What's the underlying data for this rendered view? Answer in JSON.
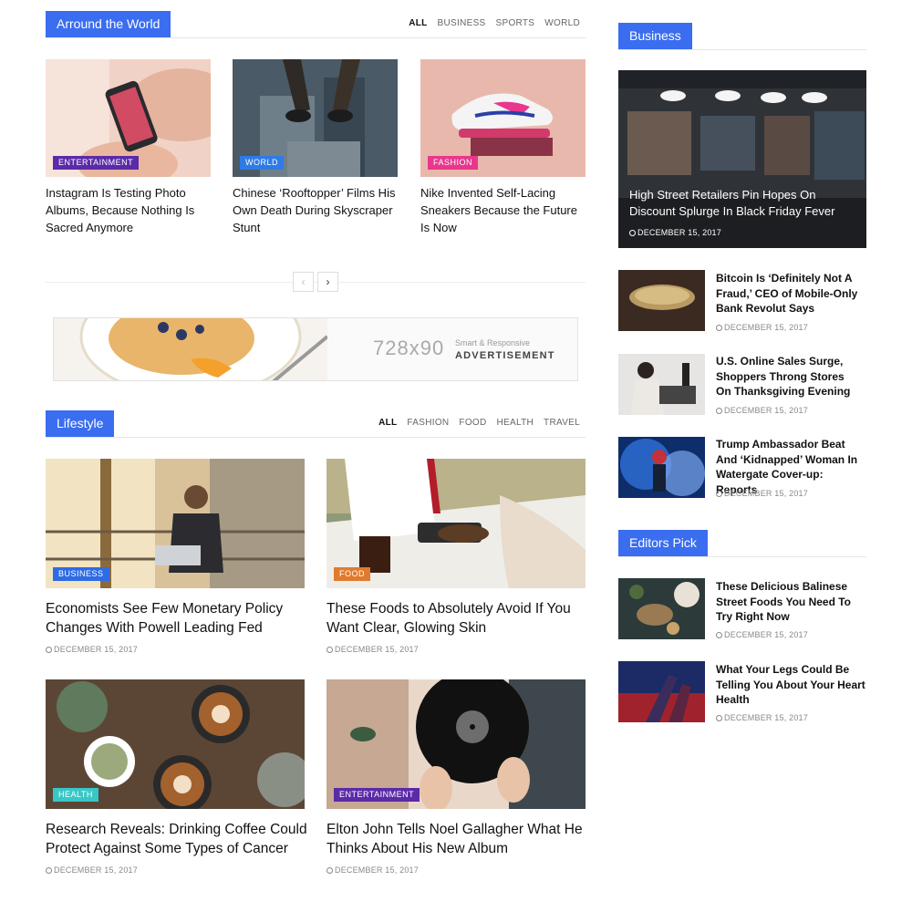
{
  "around": {
    "title": "Arround the World",
    "tabs": [
      "ALL",
      "BUSINESS",
      "SPORTS",
      "WORLD"
    ],
    "cards": [
      {
        "tag": "ENTERTAINMENT",
        "title": "Instagram Is Testing Photo Albums, Because Nothing Is Sacred Anymore"
      },
      {
        "tag": "WORLD",
        "title": "Chinese ‘Rooftopper’ Films His Own Death During Skyscraper Stunt"
      },
      {
        "tag": "FASHION",
        "title": "Nike Invented Self-Lacing Sneakers Because the Future Is Now"
      }
    ]
  },
  "pager": {
    "prev": "‹",
    "next": "›"
  },
  "ad": {
    "size": "728x90",
    "subtitle": "Smart & Responsive",
    "label": "ADVERTISEMENT"
  },
  "lifestyle": {
    "title": "Lifestyle",
    "tabs": [
      "ALL",
      "FASHION",
      "FOOD",
      "HEALTH",
      "TRAVEL"
    ],
    "cards": [
      {
        "tag": "BUSINESS",
        "title": "Economists See Few Monetary Policy Changes With Powell Leading Fed",
        "date": "DECEMBER 15, 2017"
      },
      {
        "tag": "FOOD",
        "title": "These Foods to Absolutely Avoid If You Want Clear, Glowing Skin",
        "date": "DECEMBER 15, 2017"
      },
      {
        "tag": "HEALTH",
        "title": "Research Reveals: Drinking Coffee Could Protect Against Some Types of Cancer",
        "date": "DECEMBER 15, 2017"
      },
      {
        "tag": "ENTERTAINMENT",
        "title": "Elton John Tells Noel Gallagher What He Thinks About His New Album",
        "date": "DECEMBER 15, 2017"
      }
    ]
  },
  "business": {
    "title": "Business",
    "featured": {
      "title": "High Street Retailers Pin Hopes On Discount Splurge In Black Friday Fever",
      "date": "DECEMBER 15, 2017"
    },
    "items": [
      {
        "title": "Bitcoin Is ‘Definitely Not A Fraud,’ CEO of Mobile-Only Bank Revolut Says",
        "date": "DECEMBER 15, 2017"
      },
      {
        "title": "U.S. Online Sales Surge, Shoppers Throng Stores On Thanksgiving Evening",
        "date": "DECEMBER 15, 2017"
      },
      {
        "title": "Trump Ambassador Beat And ‘Kidnapped’ Woman In Watergate Cover-up: Reports",
        "date": "DECEMBER 15, 2017"
      }
    ]
  },
  "editors": {
    "title": "Editors Pick",
    "items": [
      {
        "title": "These Delicious Balinese Street Foods You Need To Try Right Now",
        "date": "DECEMBER 15, 2017"
      },
      {
        "title": "What Your Legs Could Be Telling You About Your Heart Health",
        "date": "DECEMBER 15, 2017"
      }
    ]
  },
  "colors": {
    "accent": "#3a6df0",
    "entertainment": "#5b2aa8",
    "world": "#2f7be5",
    "fashion": "#e8378d",
    "business": "#2f6be5",
    "food": "#e07a2f",
    "health": "#39c6c6"
  }
}
